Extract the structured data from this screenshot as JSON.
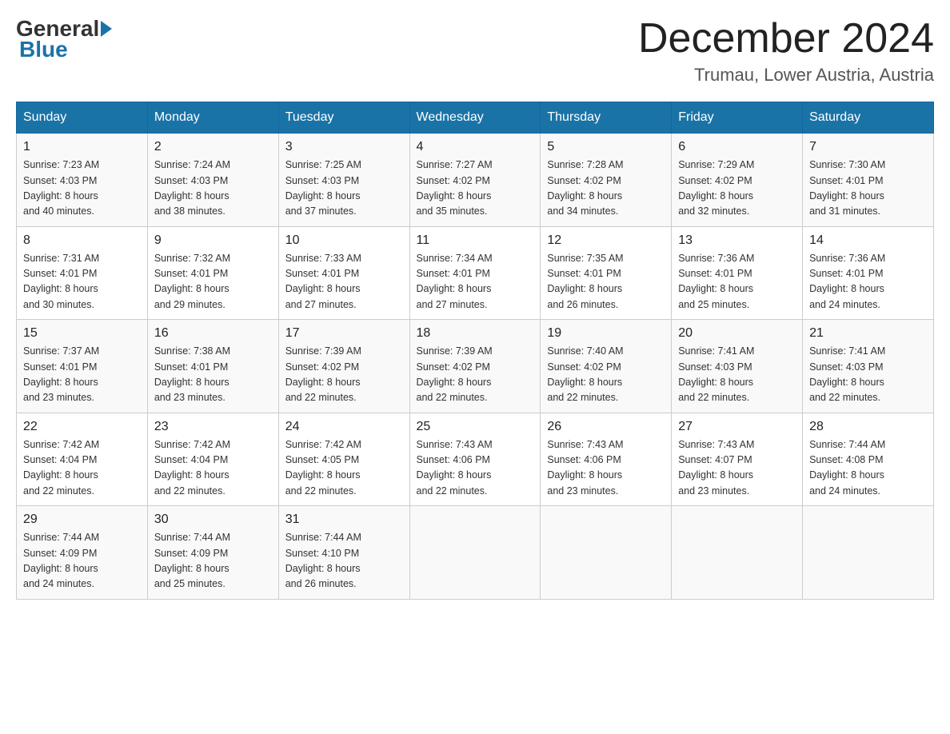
{
  "header": {
    "logo_text_general": "General",
    "logo_text_blue": "Blue",
    "month_year": "December 2024",
    "location": "Trumau, Lower Austria, Austria"
  },
  "weekdays": [
    "Sunday",
    "Monday",
    "Tuesday",
    "Wednesday",
    "Thursday",
    "Friday",
    "Saturday"
  ],
  "weeks": [
    [
      {
        "day": "1",
        "info": "Sunrise: 7:23 AM\nSunset: 4:03 PM\nDaylight: 8 hours\nand 40 minutes."
      },
      {
        "day": "2",
        "info": "Sunrise: 7:24 AM\nSunset: 4:03 PM\nDaylight: 8 hours\nand 38 minutes."
      },
      {
        "day": "3",
        "info": "Sunrise: 7:25 AM\nSunset: 4:03 PM\nDaylight: 8 hours\nand 37 minutes."
      },
      {
        "day": "4",
        "info": "Sunrise: 7:27 AM\nSunset: 4:02 PM\nDaylight: 8 hours\nand 35 minutes."
      },
      {
        "day": "5",
        "info": "Sunrise: 7:28 AM\nSunset: 4:02 PM\nDaylight: 8 hours\nand 34 minutes."
      },
      {
        "day": "6",
        "info": "Sunrise: 7:29 AM\nSunset: 4:02 PM\nDaylight: 8 hours\nand 32 minutes."
      },
      {
        "day": "7",
        "info": "Sunrise: 7:30 AM\nSunset: 4:01 PM\nDaylight: 8 hours\nand 31 minutes."
      }
    ],
    [
      {
        "day": "8",
        "info": "Sunrise: 7:31 AM\nSunset: 4:01 PM\nDaylight: 8 hours\nand 30 minutes."
      },
      {
        "day": "9",
        "info": "Sunrise: 7:32 AM\nSunset: 4:01 PM\nDaylight: 8 hours\nand 29 minutes."
      },
      {
        "day": "10",
        "info": "Sunrise: 7:33 AM\nSunset: 4:01 PM\nDaylight: 8 hours\nand 27 minutes."
      },
      {
        "day": "11",
        "info": "Sunrise: 7:34 AM\nSunset: 4:01 PM\nDaylight: 8 hours\nand 27 minutes."
      },
      {
        "day": "12",
        "info": "Sunrise: 7:35 AM\nSunset: 4:01 PM\nDaylight: 8 hours\nand 26 minutes."
      },
      {
        "day": "13",
        "info": "Sunrise: 7:36 AM\nSunset: 4:01 PM\nDaylight: 8 hours\nand 25 minutes."
      },
      {
        "day": "14",
        "info": "Sunrise: 7:36 AM\nSunset: 4:01 PM\nDaylight: 8 hours\nand 24 minutes."
      }
    ],
    [
      {
        "day": "15",
        "info": "Sunrise: 7:37 AM\nSunset: 4:01 PM\nDaylight: 8 hours\nand 23 minutes."
      },
      {
        "day": "16",
        "info": "Sunrise: 7:38 AM\nSunset: 4:01 PM\nDaylight: 8 hours\nand 23 minutes."
      },
      {
        "day": "17",
        "info": "Sunrise: 7:39 AM\nSunset: 4:02 PM\nDaylight: 8 hours\nand 22 minutes."
      },
      {
        "day": "18",
        "info": "Sunrise: 7:39 AM\nSunset: 4:02 PM\nDaylight: 8 hours\nand 22 minutes."
      },
      {
        "day": "19",
        "info": "Sunrise: 7:40 AM\nSunset: 4:02 PM\nDaylight: 8 hours\nand 22 minutes."
      },
      {
        "day": "20",
        "info": "Sunrise: 7:41 AM\nSunset: 4:03 PM\nDaylight: 8 hours\nand 22 minutes."
      },
      {
        "day": "21",
        "info": "Sunrise: 7:41 AM\nSunset: 4:03 PM\nDaylight: 8 hours\nand 22 minutes."
      }
    ],
    [
      {
        "day": "22",
        "info": "Sunrise: 7:42 AM\nSunset: 4:04 PM\nDaylight: 8 hours\nand 22 minutes."
      },
      {
        "day": "23",
        "info": "Sunrise: 7:42 AM\nSunset: 4:04 PM\nDaylight: 8 hours\nand 22 minutes."
      },
      {
        "day": "24",
        "info": "Sunrise: 7:42 AM\nSunset: 4:05 PM\nDaylight: 8 hours\nand 22 minutes."
      },
      {
        "day": "25",
        "info": "Sunrise: 7:43 AM\nSunset: 4:06 PM\nDaylight: 8 hours\nand 22 minutes."
      },
      {
        "day": "26",
        "info": "Sunrise: 7:43 AM\nSunset: 4:06 PM\nDaylight: 8 hours\nand 23 minutes."
      },
      {
        "day": "27",
        "info": "Sunrise: 7:43 AM\nSunset: 4:07 PM\nDaylight: 8 hours\nand 23 minutes."
      },
      {
        "day": "28",
        "info": "Sunrise: 7:44 AM\nSunset: 4:08 PM\nDaylight: 8 hours\nand 24 minutes."
      }
    ],
    [
      {
        "day": "29",
        "info": "Sunrise: 7:44 AM\nSunset: 4:09 PM\nDaylight: 8 hours\nand 24 minutes."
      },
      {
        "day": "30",
        "info": "Sunrise: 7:44 AM\nSunset: 4:09 PM\nDaylight: 8 hours\nand 25 minutes."
      },
      {
        "day": "31",
        "info": "Sunrise: 7:44 AM\nSunset: 4:10 PM\nDaylight: 8 hours\nand 26 minutes."
      },
      null,
      null,
      null,
      null
    ]
  ]
}
